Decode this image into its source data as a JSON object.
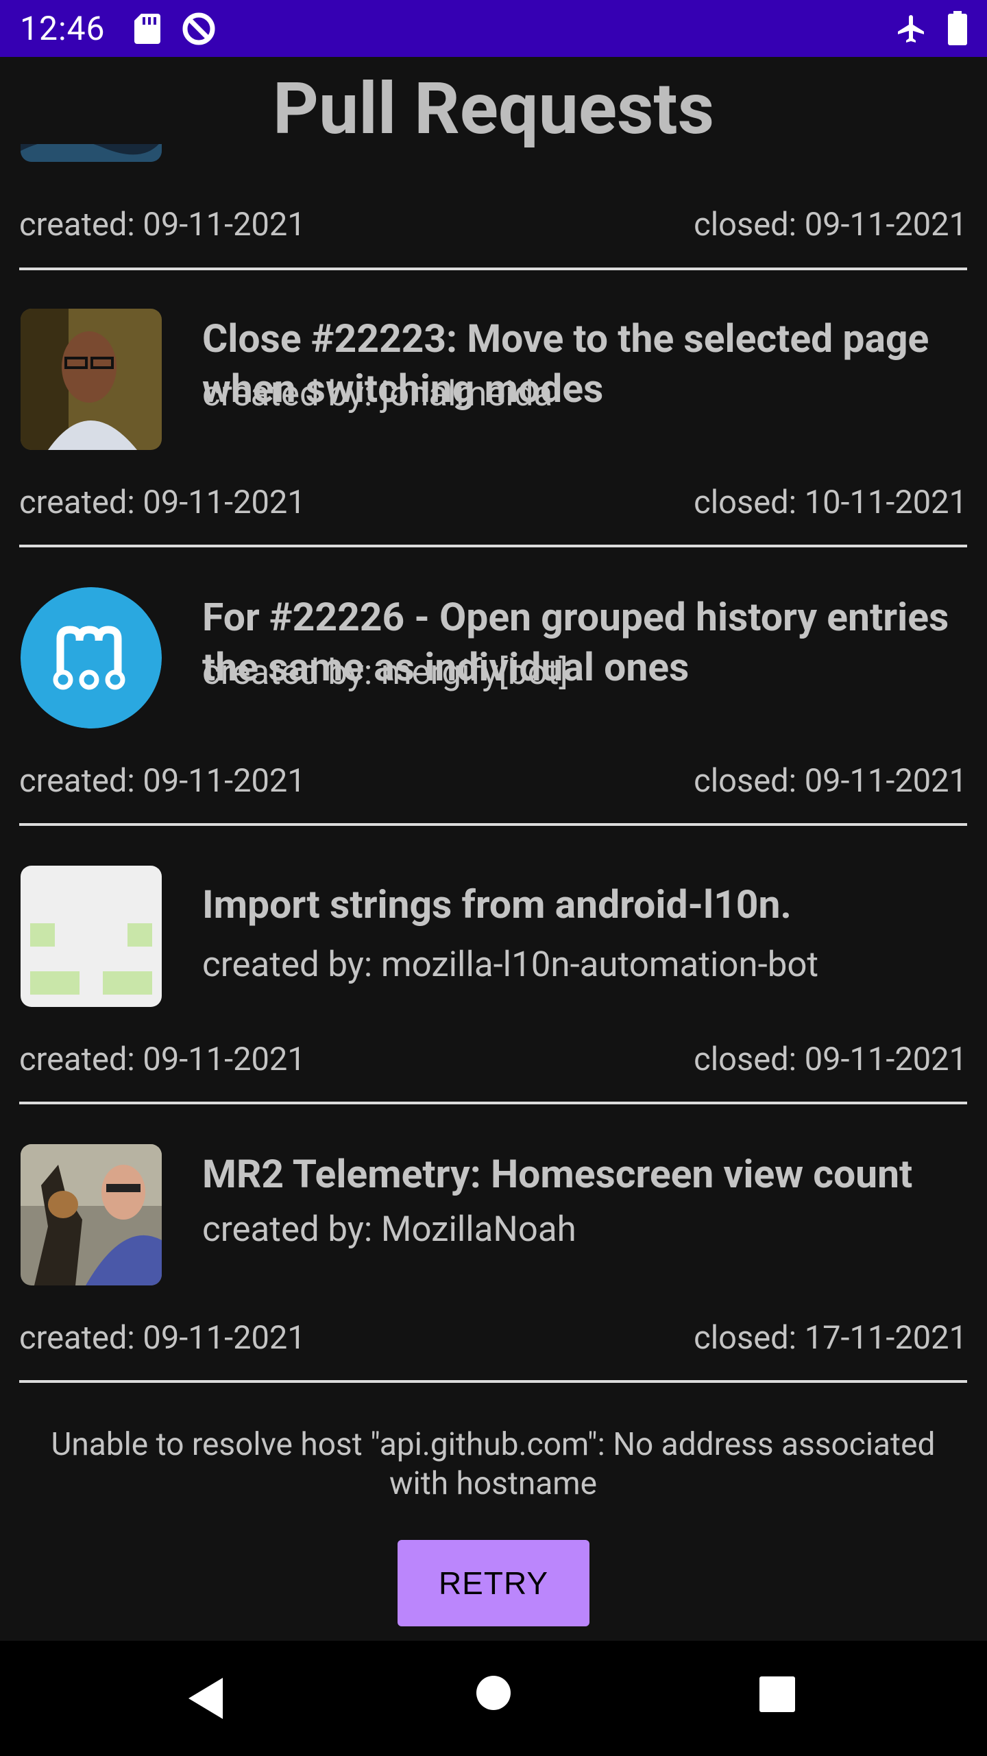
{
  "status_bar": {
    "time": "12:46"
  },
  "page": {
    "title": "Pull Requests"
  },
  "pull_requests": [
    {
      "title": "",
      "created_by": "",
      "created": "created: 09-11-2021",
      "closed": "closed: 09-11-2021"
    },
    {
      "title": "Close #22223: Move to the selected page when switching modes",
      "created_by": "created by: jonalmeida",
      "created": "created: 09-11-2021",
      "closed": "closed: 10-11-2021"
    },
    {
      "title": "For #22226 - Open grouped history entries the same as individual ones",
      "created_by": "created by: mergify[bot]",
      "created": "created: 09-11-2021",
      "closed": "closed: 09-11-2021"
    },
    {
      "title": "Import strings from android-l10n.",
      "created_by": "created by: mozilla-l10n-automation-bot",
      "created": "created: 09-11-2021",
      "closed": "closed: 09-11-2021"
    },
    {
      "title": "MR2 Telemetry: Homescreen view count",
      "created_by": "created by: MozillaNoah",
      "created": "created: 09-11-2021",
      "closed": "closed: 17-11-2021"
    }
  ],
  "error": {
    "message": "Unable to resolve host \"api.github.com\": No address associated with hostname"
  },
  "retry_button": {
    "label": "RETRY"
  },
  "colors": {
    "status_bar": "#3600b3",
    "background": "#121212",
    "accent": "#bb86fc"
  }
}
